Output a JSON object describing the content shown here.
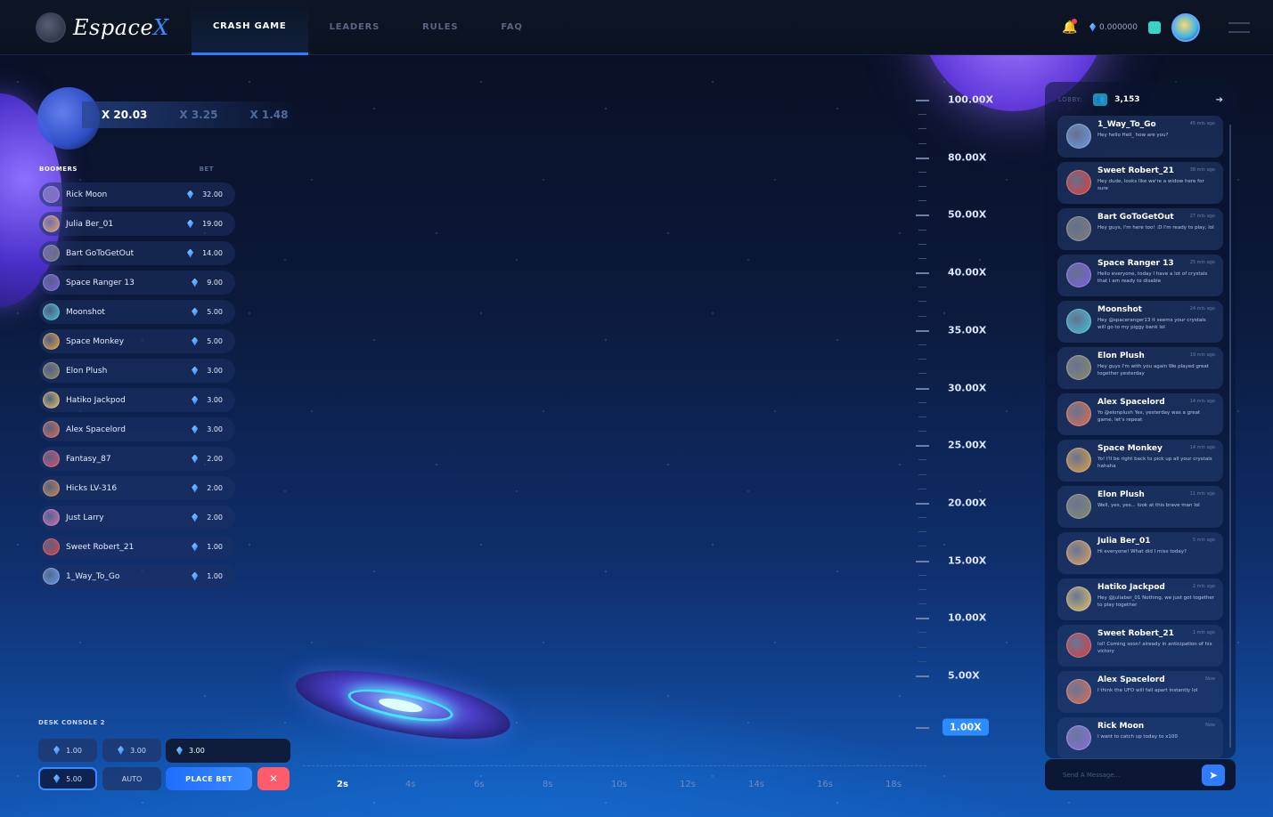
{
  "brand": {
    "name_main": "Espace",
    "name_accent": "X"
  },
  "nav": {
    "tabs": [
      "CRASH GAME",
      "LEADERS",
      "RULES",
      "FAQ"
    ],
    "active": 0
  },
  "wallet": {
    "balance": "0.000000"
  },
  "history": {
    "current": "X 20.03",
    "previous": [
      "X 3.25",
      "X 1.48"
    ]
  },
  "boomers": {
    "title": "BOOMERS",
    "bet_header": "BET",
    "rows": [
      {
        "name": "Rick Moon",
        "bet": "32.00",
        "color": "#8c6bd8"
      },
      {
        "name": "Julia Ber_01",
        "bet": "19.00",
        "color": "#e0a060"
      },
      {
        "name": "Bart GoToGetOut",
        "bet": "14.00",
        "color": "#7b7b7b"
      },
      {
        "name": "Space Ranger 13",
        "bet": "9.00",
        "color": "#7a5ce0"
      },
      {
        "name": "Moonshot",
        "bet": "5.00",
        "color": "#3fc0d8"
      },
      {
        "name": "Space Monkey",
        "bet": "5.00",
        "color": "#e0a040"
      },
      {
        "name": "Elon Plush",
        "bet": "3.00",
        "color": "#8a8a6a"
      },
      {
        "name": "Hatiko Jackpod",
        "bet": "3.00",
        "color": "#e0c060"
      },
      {
        "name": "Alex Spacelord",
        "bet": "3.00",
        "color": "#e06a4a"
      },
      {
        "name": "Fantasy_87",
        "bet": "2.00",
        "color": "#e04a6a"
      },
      {
        "name": "Hicks LV-316",
        "bet": "2.00",
        "color": "#d08040"
      },
      {
        "name": "Just Larry",
        "bet": "2.00",
        "color": "#d06ab0"
      },
      {
        "name": "Sweet Robert_21",
        "bet": "1.00",
        "color": "#e03a3a"
      },
      {
        "name": "1_Way_To_Go",
        "bet": "1.00",
        "color": "#6a9ae0"
      }
    ]
  },
  "scale": {
    "labels": [
      "100.00X",
      "80.00X",
      "50.00X",
      "40.00X",
      "35.00X",
      "30.00X",
      "25.00X",
      "20.00X",
      "15.00X",
      "10.00X",
      "5.00X",
      "1.00X"
    ],
    "current": "1.00X"
  },
  "time_axis": {
    "labels": [
      "2s",
      "4s",
      "6s",
      "8s",
      "10s",
      "12s",
      "14s",
      "16s",
      "18s"
    ],
    "active": "2s"
  },
  "console": {
    "title": "DESK CONSOLE 2",
    "quick_bets": [
      "1.00",
      "3.00",
      "5.00"
    ],
    "selected_quick_bet": "5.00",
    "bet_input": "3.00",
    "auto_label": "AUTO",
    "place_bet_label": "PLACE BET",
    "cancel_symbol": "✕"
  },
  "chat": {
    "lobby_label": "LOBBY:",
    "lobby_count": "3,153",
    "input_placeholder": "Send A Message...",
    "messages": [
      {
        "name": "1_Way_To_Go",
        "time": "45 min ago",
        "text": "Hey hello Hell_ how are you?",
        "color": "#6a9ae0"
      },
      {
        "name": "Sweet Robert_21",
        "time": "38 min ago",
        "text": "Hey dude, looks like we're a widow here for sure",
        "color": "#e03a3a"
      },
      {
        "name": "Bart GoToGetOut",
        "time": "27 min ago",
        "text": "Hey guys, I'm here too! :D I'm ready to play, lol",
        "color": "#7b7b7b"
      },
      {
        "name": "Space Ranger 13",
        "time": "25 min ago",
        "text": "Hello everyone, today I have a lot of crystals that I am ready to disable",
        "color": "#7a5ce0"
      },
      {
        "name": "Moonshot",
        "time": "24 min ago",
        "text": "Hey @spaceranger13 it seems your crystals will go to my piggy bank lol",
        "color": "#3fc0d8"
      },
      {
        "name": "Elon Plush",
        "time": "19 min ago",
        "text": "Hey guys I'm with you again We played great together yesterday",
        "color": "#8a8a6a"
      },
      {
        "name": "Alex Spacelord",
        "time": "14 min ago",
        "text": "Yo @elonplush Yes, yesterday was a great game, let's repeat",
        "color": "#e06a4a"
      },
      {
        "name": "Space Monkey",
        "time": "14 min ago",
        "text": "Yo! I'll be right back to pick up all your crystals hahaha",
        "color": "#e0a040"
      },
      {
        "name": "Elon Plush",
        "time": "11 min ago",
        "text": "Well, yes, yes... look at this brave man lol",
        "color": "#8a8a6a"
      },
      {
        "name": "Julia Ber_01",
        "time": "5 min ago",
        "text": "Hi everyone! What did I miss today?",
        "color": "#e0a060"
      },
      {
        "name": "Hatiko Jackpod",
        "time": "2 min ago",
        "text": "Hey @juliaber_01 Nothing, we just got together to play together",
        "color": "#e0c060"
      },
      {
        "name": "Sweet Robert_21",
        "time": "1 min ago",
        "text": "lol! Coming soon! already in anticipation of his victory",
        "color": "#e03a3a"
      },
      {
        "name": "Alex Spacelord",
        "time": "Now",
        "text": "I think the UFO will fall apart instantly lol",
        "color": "#e06a4a"
      },
      {
        "name": "Rick Moon",
        "time": "Now",
        "text": "I want to catch up today to x100",
        "color": "#8c6bd8"
      }
    ]
  }
}
